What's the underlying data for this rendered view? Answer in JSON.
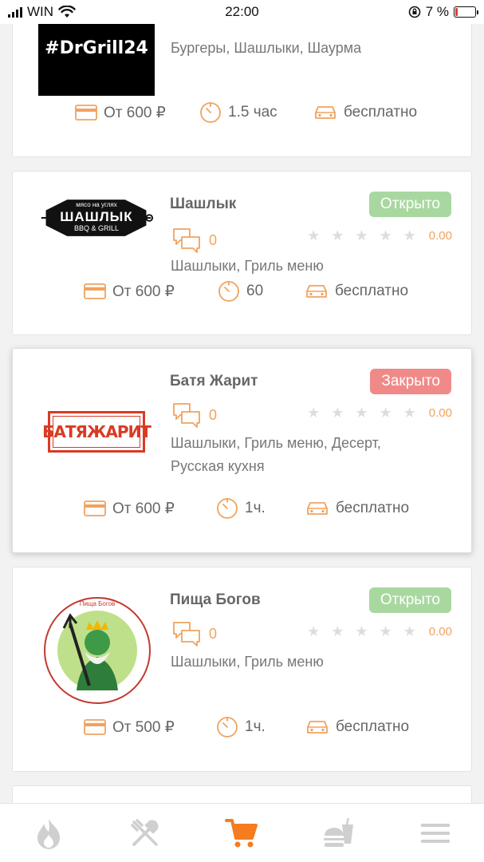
{
  "status_bar": {
    "carrier": "WIN",
    "time": "22:00",
    "battery": "7 %"
  },
  "restaurants": [
    {
      "logo_text": "#DrGrill24",
      "cuisine": "Бургеры, Шашлыки, Шаурма",
      "min_order": "От 600 ₽",
      "delivery_time": "1.5 час",
      "delivery_cost": "бесплатно"
    },
    {
      "name": "Шашлык",
      "status": "Открыто",
      "logo_text_top": "мясо на углях",
      "logo_text_main": "ШАШЛЫК",
      "logo_text_sub": "BBQ & GRILL",
      "reviews": "0",
      "rating": "0.00",
      "cuisine": "Шашлыки, Гриль меню",
      "min_order": "От 600 ₽",
      "delivery_time": "60",
      "delivery_cost": "бесплатно"
    },
    {
      "name": "Батя Жарит",
      "status": "Закрыто",
      "logo_text": "БАТЯЖАРИТ",
      "reviews": "0",
      "rating": "0.00",
      "cuisine": "Шашлыки, Гриль меню, Десерт, Русская кухня",
      "min_order": "От 600 ₽",
      "delivery_time": "1ч.",
      "delivery_cost": "бесплатно"
    },
    {
      "name": "Пища Богов",
      "status": "Открыто",
      "logo_text": "Пища Богов",
      "reviews": "0",
      "rating": "0.00",
      "cuisine": "Шашлыки, Гриль меню",
      "min_order": "От 500 ₽",
      "delivery_time": "1ч.",
      "delivery_cost": "бесплатно"
    }
  ],
  "nav": [
    {
      "icon": "flame-icon",
      "active": false
    },
    {
      "icon": "cutlery-icon",
      "active": false
    },
    {
      "icon": "cart-icon",
      "active": true
    },
    {
      "icon": "burger-drink-icon",
      "active": false
    },
    {
      "icon": "menu-icon",
      "active": false
    }
  ],
  "colors": {
    "accent": "#f0a35e",
    "open": "#a8d8a0",
    "closed": "#f08a88",
    "nav_active": "#f57c1f",
    "nav_inactive": "#cfcfcf"
  }
}
